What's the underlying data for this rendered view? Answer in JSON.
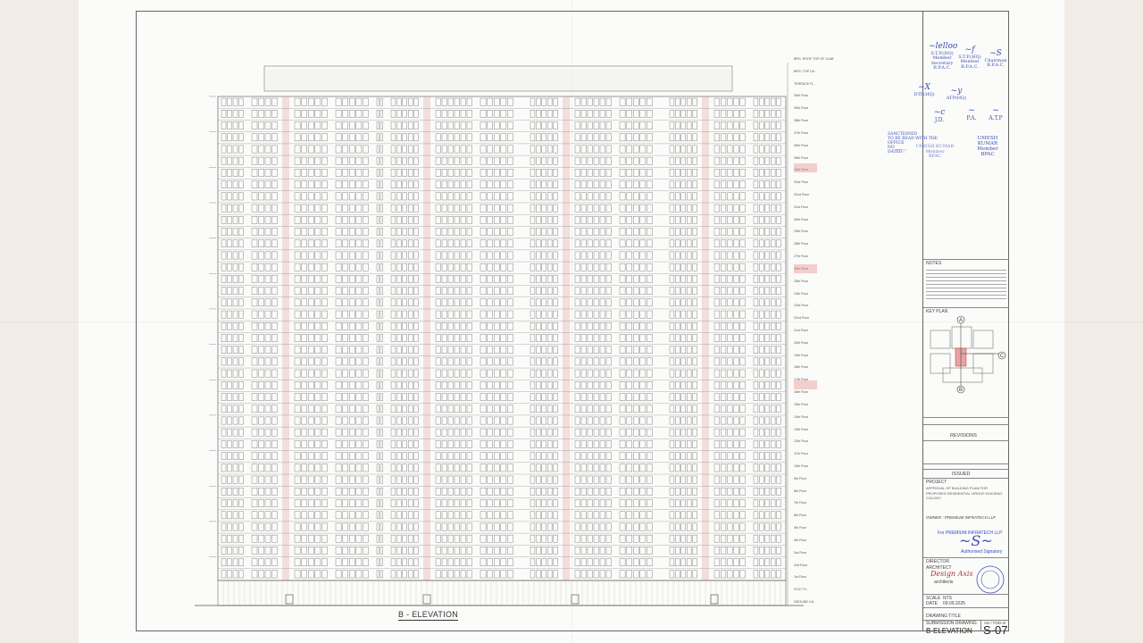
{
  "drawing": {
    "view_title": "B - ELEVATION",
    "owner": "OWNER : PREMIUM INFRATECH LLP",
    "project_label": "PROJECT",
    "project_text": "APPROVAL OF BUILDING PLAN FOR PROPOSED RESIDENTIAL GROUP HOUSING COLONY",
    "revisions_label": "REVISIONS",
    "issued_label": "ISSUED",
    "director_label": "DIRECTOR",
    "architect_label": "ARCHITECT",
    "architect_name": "Design Axis",
    "architect_sub": "architects",
    "for_company": "For PREMIUM INFRATECH LLP",
    "auth_sign": "Authorised Signatory",
    "scale_label": "SCALE",
    "date_label": "DATE",
    "date_value": "09.09.2025",
    "nts": "NTS",
    "drawing_title_label": "DRAWING TITLE",
    "drawing_type": "SUBMISSION DRAWING",
    "drawing_title": "B-ELEVATION",
    "drawing_no": "S-07",
    "drawing_ref": "AS / TOD-2/",
    "notes_label": "NOTES",
    "keyplan_label": "KEY PLAN",
    "keyplan_marks": [
      "A",
      "B",
      "C"
    ],
    "sanction": "SANCTIONED\nTO BE READ WITH THE OFFICE\nNO ______\nDATED :",
    "signatures": [
      {
        "role": "S.T.P.(HQ)\nMember Secretary\nB.P.A.C."
      },
      {
        "role": "S.T.P.(HQ)\nMember\nB.P.A.C."
      },
      {
        "role": "Chairman\nB.P.A.C."
      },
      {
        "role": "DTP(HQ)"
      },
      {
        "role": "ATP(HQ)"
      },
      {
        "role": "J.D."
      },
      {
        "role": "P.A."
      },
      {
        "role": "A.T.P"
      }
    ],
    "member_stamp": "UMESH KUMAR\nMember\nBPAC"
  },
  "colors": {
    "ink": "#333333",
    "stamp_blue": "#3a4fb6",
    "highlight_pink": "#e69696"
  },
  "levels": [
    "BRG. ROOF TOP OF SLAB",
    "BRG. TOP LVL",
    "TERRACE FL.",
    "40th Floor",
    "39th Floor",
    "38th Floor",
    "37th Floor",
    "36th Floor",
    "35th Floor",
    "34th Floor",
    "33rd Floor",
    "32nd Floor",
    "31st Floor",
    "30th Floor",
    "29th Floor",
    "28th Floor",
    "27th Floor",
    "26th Floor",
    "25th Floor",
    "24th Floor",
    "23rd Floor",
    "22nd Floor",
    "21st Floor",
    "20th Floor",
    "19th Floor",
    "18th Floor",
    "17th Floor",
    "16th Floor",
    "15th Floor",
    "14th Floor",
    "13th Floor",
    "12th Floor",
    "11th Floor",
    "10th Floor",
    "9th Floor",
    "8th Floor",
    "7th Floor",
    "6th Floor",
    "5th Floor",
    "4th Floor",
    "3rd Floor",
    "2nd Floor",
    "1st Floor",
    "STILT FL.",
    "GROUND LVL"
  ]
}
